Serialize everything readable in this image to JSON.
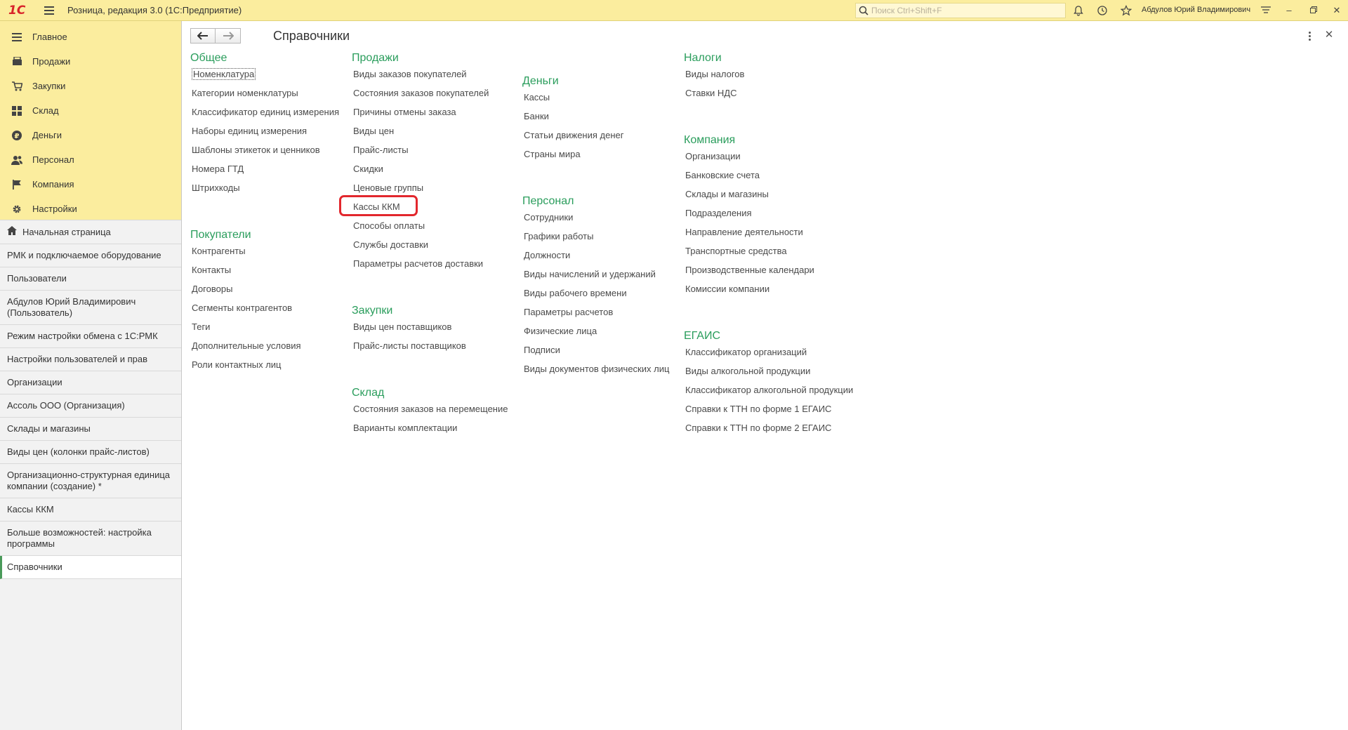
{
  "app": {
    "title": "Розница, редакция 3.0  (1С:Предприятие)",
    "logo": "1С",
    "search_placeholder": "Поиск Ctrl+Shift+F",
    "user": "Абдулов Юрий Владимирович"
  },
  "sections": [
    {
      "label": "Главное",
      "icon": "menu-icon"
    },
    {
      "label": "Продажи",
      "icon": "sales-icon"
    },
    {
      "label": "Закупки",
      "icon": "purchases-icon"
    },
    {
      "label": "Склад",
      "icon": "warehouse-icon"
    },
    {
      "label": "Деньги",
      "icon": "money-icon"
    },
    {
      "label": "Персонал",
      "icon": "staff-icon"
    },
    {
      "label": "Компания",
      "icon": "flag-icon"
    },
    {
      "label": "Настройки",
      "icon": "gear-icon"
    }
  ],
  "open_windows": [
    "Начальная страница",
    "РМК и подключаемое оборудование",
    "Пользователи",
    "Абдулов Юрий Владимирович (Пользователь)",
    "Режим настройки обмена с 1С:РМК",
    "Настройки пользователей и прав",
    "Организации",
    "Ассоль ООО (Организация)",
    "Склады и магазины",
    "Виды цен (колонки прайс-листов)",
    "Организационно-структурная единица компании (создание) *",
    "Кассы ККМ",
    "Больше возможностей: настройка программы",
    "Справочники"
  ],
  "page": {
    "title": "Справочники"
  },
  "groups": {
    "general": {
      "title": "Общее",
      "links": [
        "Номенклатура",
        "Категории номенклатуры",
        "Классификатор единиц измерения",
        "Наборы единиц измерения",
        "Шаблоны этикеток и ценников",
        "Номера ГТД",
        "Штрихкоды"
      ]
    },
    "customers": {
      "title": "Покупатели",
      "links": [
        "Контрагенты",
        "Контакты",
        "Договоры",
        "Сегменты контрагентов",
        "Теги",
        "Дополнительные условия",
        "Роли контактных лиц"
      ]
    },
    "sales": {
      "title": "Продажи",
      "links": [
        "Виды заказов покупателей",
        "Состояния заказов покупателей",
        "Причины отмены заказа",
        "Виды цен",
        "Прайс-листы",
        "Скидки",
        "Ценовые группы",
        "Кассы ККМ",
        "Способы оплаты",
        "Службы доставки",
        "Параметры расчетов доставки"
      ]
    },
    "purchases": {
      "title": "Закупки",
      "links": [
        "Виды цен поставщиков",
        "Прайс-листы поставщиков"
      ]
    },
    "warehouse": {
      "title": "Склад",
      "links": [
        "Состояния заказов на перемещение",
        "Варианты комплектации"
      ]
    },
    "money": {
      "title": "Деньги",
      "links": [
        "Кассы",
        "Банки",
        "Статьи движения денег",
        "Страны мира"
      ]
    },
    "staff": {
      "title": "Персонал",
      "links": [
        "Сотрудники",
        "Графики работы",
        "Должности",
        "Виды начислений и удержаний",
        "Виды рабочего времени",
        "Параметры расчетов",
        "Физические лица",
        "Подписи",
        "Виды документов физических лиц"
      ]
    },
    "taxes": {
      "title": "Налоги",
      "links": [
        "Виды налогов",
        "Ставки НДС"
      ]
    },
    "company": {
      "title": "Компания",
      "links": [
        "Организации",
        "Банковские счета",
        "Склады и магазины",
        "Подразделения",
        "Направление деятельности",
        "Транспортные средства",
        "Производственные календари",
        "Комиссии компании"
      ]
    },
    "egais": {
      "title": "ЕГАИС",
      "links": [
        "Классификатор организаций",
        "Виды алкогольной продукции",
        "Классификатор алкогольной продукции",
        "Справки к ТТН по форме 1 ЕГАИС",
        "Справки к ТТН по форме 2 ЕГАИС"
      ]
    }
  },
  "colors": {
    "top_bar": "#fbed9e",
    "group_title": "#2a9d5c",
    "highlight": "#e2272d"
  }
}
